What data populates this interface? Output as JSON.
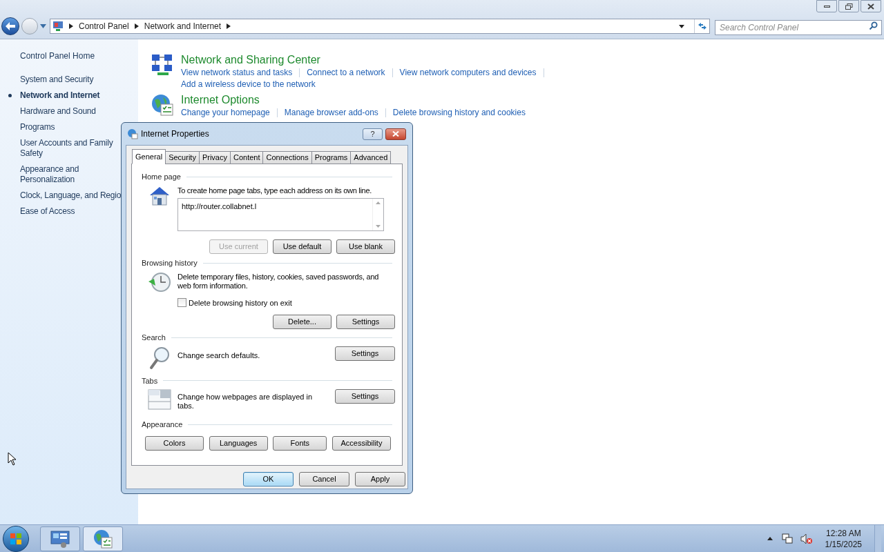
{
  "address_bar": {
    "breadcrumbs": [
      "Control Panel",
      "Network and Internet"
    ]
  },
  "search": {
    "placeholder": "Search Control Panel"
  },
  "sidebar": {
    "home": "Control Panel Home",
    "items": [
      {
        "label": "System and Security",
        "selected": false
      },
      {
        "label": "Network and Internet",
        "selected": true
      },
      {
        "label": "Hardware and Sound",
        "selected": false
      },
      {
        "label": "Programs",
        "selected": false
      },
      {
        "label": "User Accounts and Family Safety",
        "selected": false
      },
      {
        "label": "Appearance and Personalization",
        "selected": false
      },
      {
        "label": "Clock, Language, and Regio",
        "selected": false
      },
      {
        "label": "Ease of Access",
        "selected": false
      }
    ]
  },
  "categories": [
    {
      "kind": "network",
      "title": "Network and Sharing Center",
      "links": [
        "View network status and tasks",
        "Connect to a network",
        "View network computers and devices",
        "Add a wireless device to the network"
      ]
    },
    {
      "kind": "internet",
      "title": "Internet Options",
      "links": [
        "Change your homepage",
        "Manage browser add-ons",
        "Delete browsing history and cookies"
      ]
    }
  ],
  "dialog": {
    "title": "Internet Properties",
    "help": "?",
    "tabs": [
      {
        "label": "General",
        "selected": true
      },
      {
        "label": "Security",
        "selected": false
      },
      {
        "label": "Privacy",
        "selected": false
      },
      {
        "label": "Content",
        "selected": false
      },
      {
        "label": "Connections",
        "selected": false
      },
      {
        "label": "Programs",
        "selected": false
      },
      {
        "label": "Advanced",
        "selected": false
      }
    ],
    "sections": [
      {
        "kind": "home",
        "heading": "Home page",
        "text": "To create home page tabs, type each address on its own line.",
        "value": "http://router.collabnet.l",
        "buttons": [
          {
            "label": "Use current",
            "disabled": true
          },
          {
            "label": "Use default",
            "disabled": false
          },
          {
            "label": "Use blank",
            "disabled": false
          }
        ]
      },
      {
        "kind": "history",
        "heading": "Browsing history",
        "text": "Delete temporary files, history, cookies, saved passwords, and web form information.",
        "checkbox": {
          "label": "Delete browsing history on exit",
          "checked": false
        },
        "buttons": [
          {
            "label": "Delete...",
            "disabled": false
          },
          {
            "label": "Settings",
            "disabled": false
          }
        ]
      },
      {
        "kind": "search",
        "heading": "Search",
        "text": "Change search defaults.",
        "buttons": [
          {
            "label": "Settings",
            "disabled": false
          }
        ]
      },
      {
        "kind": "tabs",
        "heading": "Tabs",
        "text": "Change how webpages are displayed in tabs.",
        "buttons": [
          {
            "label": "Settings",
            "disabled": false
          }
        ]
      },
      {
        "kind": "appearance",
        "heading": "Appearance",
        "buttons": [
          {
            "label": "Colors",
            "disabled": false
          },
          {
            "label": "Languages",
            "disabled": false
          },
          {
            "label": "Fonts",
            "disabled": false
          },
          {
            "label": "Accessibility",
            "disabled": false
          }
        ]
      }
    ],
    "footer": [
      {
        "label": "OK",
        "default": true
      },
      {
        "label": "Cancel",
        "default": false
      },
      {
        "label": "Apply",
        "default": false
      }
    ]
  },
  "taskbar": {
    "time": "12:28 AM",
    "date": "1/15/2025"
  }
}
